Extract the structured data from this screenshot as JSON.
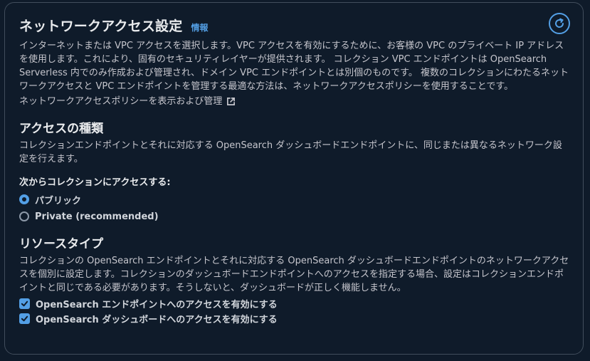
{
  "header": {
    "title": "ネットワークアクセス設定",
    "info_link": "情報"
  },
  "intro": {
    "description": "インターネットまたは VPC アクセスを選択します。VPC アクセスを有効にするために、お客様の VPC のプライベート IP アドレスを使用します。これにより、固有のセキュリティレイヤーが提供されます。 コレクション VPC エンドポイントは OpenSearch Serverless 内でのみ作成および管理され、ドメイン VPC エンドポイントとは別個のものです。 複数のコレクションにわたるネットワークアクセスと VPC エンドポイントを管理する最適な方法は、ネットワークアクセスポリシーを使用することです。",
    "manage_link": "ネットワークアクセスポリシーを表示および管理"
  },
  "access_type": {
    "title": "アクセスの種類",
    "description": "コレクションエンドポイントとそれに対応する OpenSearch ダッシュボードエンドポイントに、同じまたは異なるネットワーク設定を行えます。",
    "field_label": "次からコレクションにアクセスする:",
    "options": [
      {
        "label": "パブリック",
        "selected": true
      },
      {
        "label": "Private (recommended)",
        "selected": false
      }
    ]
  },
  "resource_type": {
    "title": "リソースタイプ",
    "description": "コレクションの OpenSearch エンドポイントとそれに対応する OpenSearch ダッシュボードエンドポイントのネットワークアクセスを個別に設定します。コレクションのダッシュボードエンドポイントへのアクセスを指定する場合、設定はコレクションエンドポイントと同じである必要があります。そうしないと、ダッシュボードが正しく機能しません。",
    "checkboxes": [
      {
        "label": "OpenSearch エンドポイントへのアクセスを有効にする",
        "checked": true
      },
      {
        "label": "OpenSearch ダッシュボードへのアクセスを有効にする",
        "checked": true
      }
    ]
  },
  "colors": {
    "background": "#0f1b2a",
    "border": "#414d5c",
    "accent": "#539fe5",
    "heading": "#e9ebed",
    "body_text": "#c6c6cd"
  },
  "icons": {
    "refresh": "refresh-icon",
    "external": "external-link-icon",
    "check": "checkmark-icon"
  }
}
